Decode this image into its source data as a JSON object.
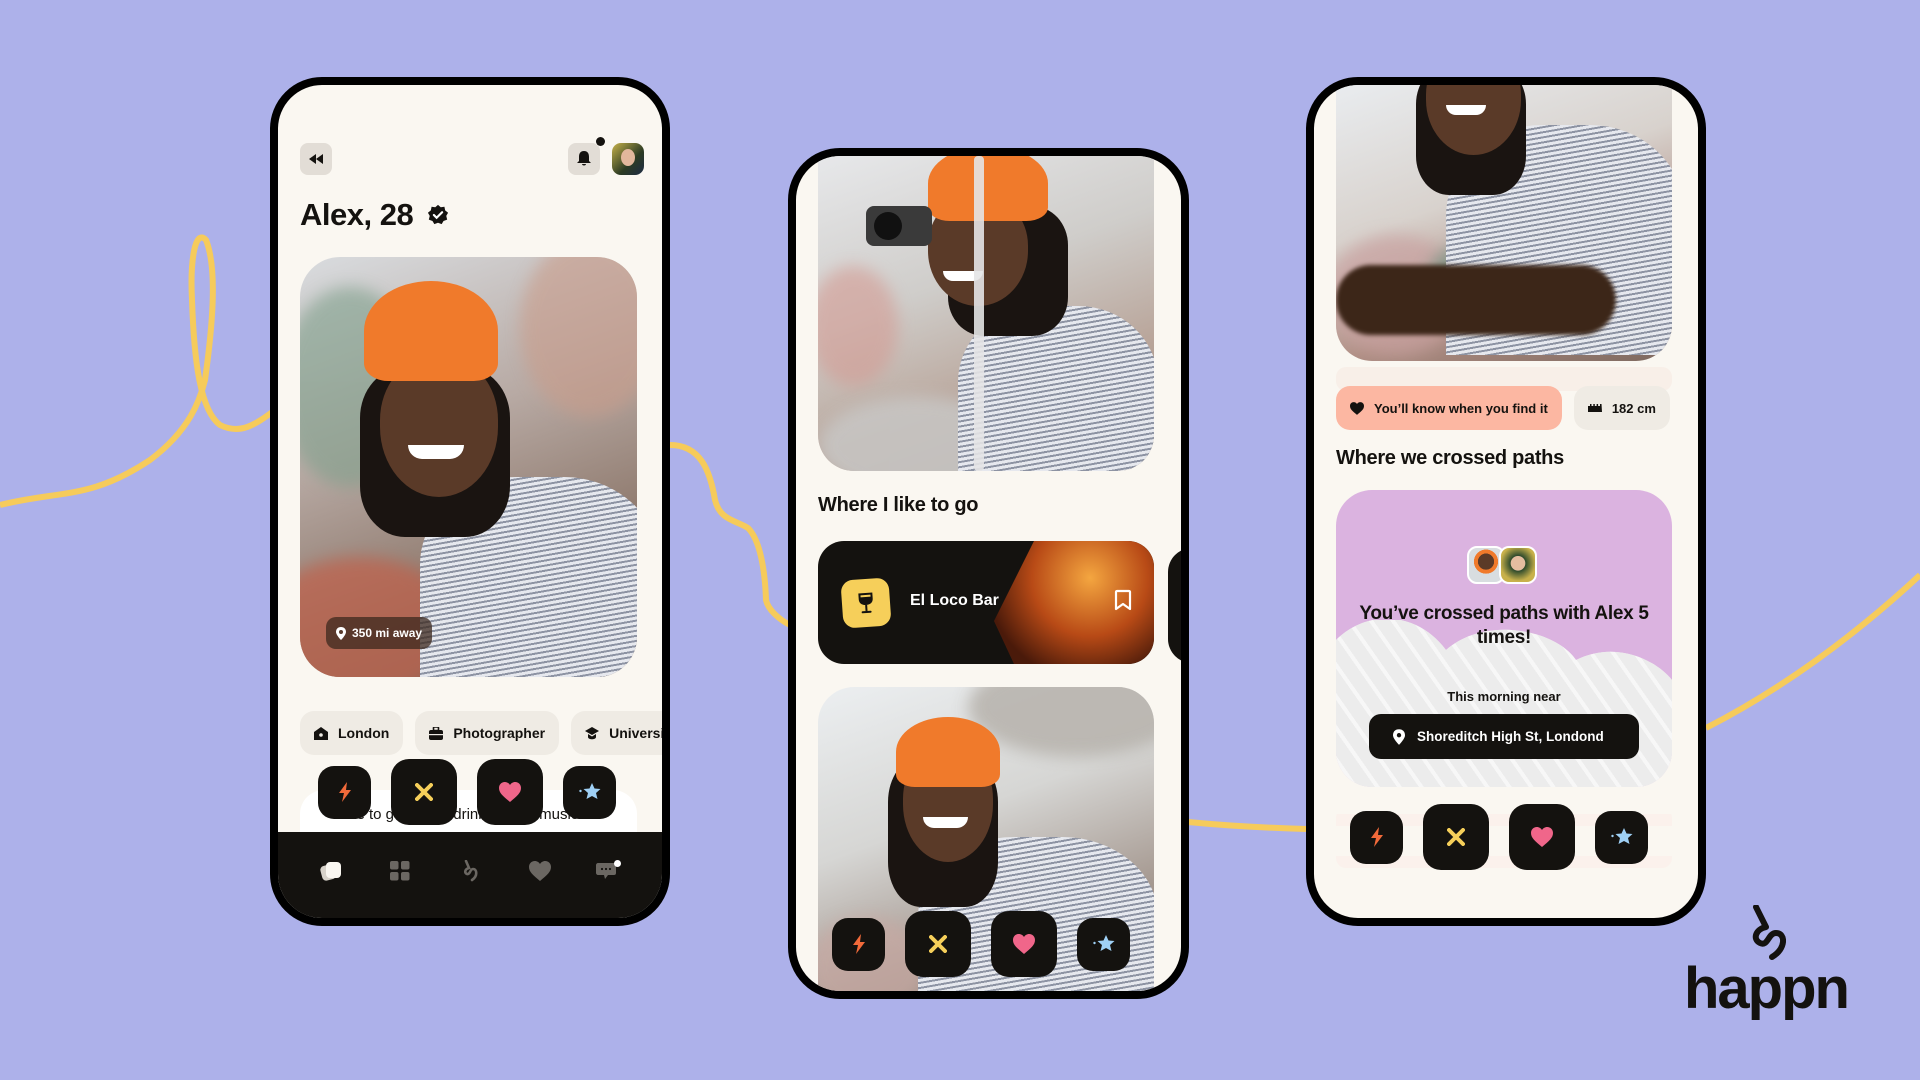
{
  "brand": {
    "name": "happn",
    "accent": "#f6cf5a",
    "background": "#adb1ea"
  },
  "phone1": {
    "header": {
      "back_icon": "rewind-icon",
      "notification_icon": "bell-icon",
      "has_unread": true,
      "avatar": "user-avatar"
    },
    "profile": {
      "name_age": "Alex, 28",
      "verified": true,
      "distance": "350 mi away"
    },
    "tags": [
      {
        "icon": "home-icon",
        "label": "London"
      },
      {
        "icon": "briefcase-icon",
        "label": "Photographer"
      },
      {
        "icon": "graduation-cap-icon",
        "label": "University"
      }
    ],
    "actions": [
      {
        "icon": "bolt-icon",
        "name": "boost",
        "color": "#f26a3a"
      },
      {
        "icon": "x-icon",
        "name": "pass",
        "color": "#f6cf5a"
      },
      {
        "icon": "heart-icon",
        "name": "like",
        "color": "#f0668a"
      },
      {
        "icon": "star-icon",
        "name": "super-like",
        "color": "#9fd0f5"
      }
    ],
    "bio": "I like to go out for drinks, go to music festivals and sing",
    "nav": [
      {
        "icon": "cards-icon",
        "label": "Timeline",
        "active": true
      },
      {
        "icon": "grid-icon",
        "label": "Map",
        "active": false
      },
      {
        "icon": "happn-icon",
        "label": "Happn",
        "active": false
      },
      {
        "icon": "heart-icon",
        "label": "Likes",
        "active": false
      },
      {
        "icon": "chat-icon",
        "label": "Messages",
        "active": false,
        "badge": true
      }
    ]
  },
  "phone2": {
    "section_title": "Where I like to go",
    "place": {
      "icon": "wine-glass-icon",
      "name": "El Loco Bar",
      "bookmark_icon": "bookmark-icon"
    },
    "actions": [
      {
        "icon": "bolt-icon",
        "name": "boost"
      },
      {
        "icon": "x-icon",
        "name": "pass"
      },
      {
        "icon": "heart-icon",
        "name": "like"
      },
      {
        "icon": "star-icon",
        "name": "super-like"
      }
    ]
  },
  "phone3": {
    "tags": [
      {
        "icon": "heart-icon",
        "label": "You’ll know when you find it"
      },
      {
        "icon": "ruler-icon",
        "label": "182 cm"
      }
    ],
    "section_title": "Where we crossed paths",
    "crossed": {
      "headline": "You’ve crossed paths with Alex 5 times!",
      "when": "This morning near",
      "location": "Shoreditch High St, Londond"
    },
    "actions": [
      {
        "icon": "bolt-icon",
        "name": "boost"
      },
      {
        "icon": "x-icon",
        "name": "pass"
      },
      {
        "icon": "heart-icon",
        "name": "like"
      },
      {
        "icon": "star-icon",
        "name": "super-like"
      }
    ]
  }
}
